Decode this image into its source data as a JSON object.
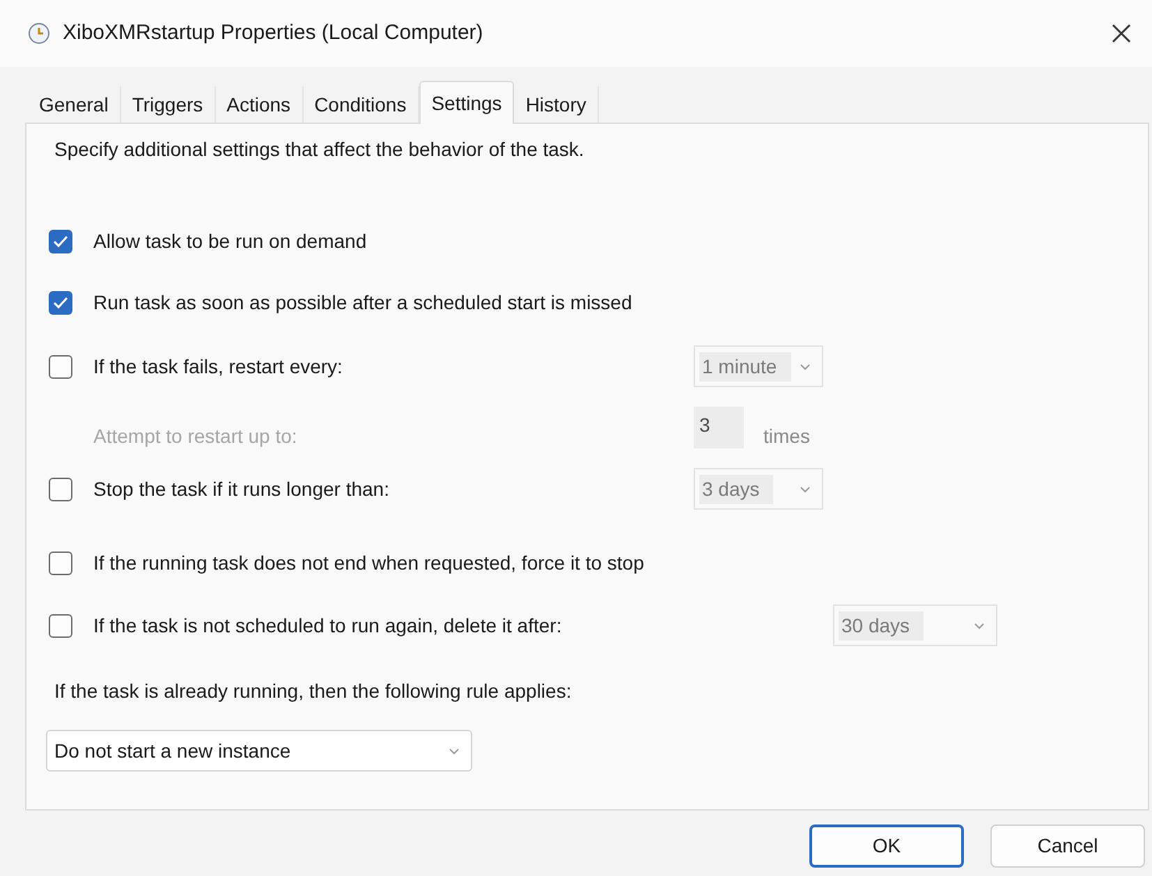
{
  "window": {
    "title": "XiboXMRstartup Properties (Local Computer)"
  },
  "tabs": [
    {
      "label": "General",
      "selected": false
    },
    {
      "label": "Triggers",
      "selected": false
    },
    {
      "label": "Actions",
      "selected": false
    },
    {
      "label": "Conditions",
      "selected": false
    },
    {
      "label": "Settings",
      "selected": true
    },
    {
      "label": "History",
      "selected": false
    }
  ],
  "description": "Specify additional settings that affect the behavior of the task.",
  "options": [
    {
      "kind": "checkbox",
      "label": "Allow task to be run on demand",
      "checked": true
    },
    {
      "kind": "checkbox",
      "label": "Run task as soon as possible after a scheduled start is missed",
      "checked": true
    },
    {
      "kind": "checkbox",
      "label": "If the task fails, restart every:",
      "checked": false,
      "dropdown": {
        "value": "1 minute",
        "disabled": true
      }
    },
    {
      "kind": "number",
      "label": "Attempt to restart up to:",
      "disabled": true,
      "value": "3",
      "unit": "times"
    },
    {
      "kind": "checkbox",
      "label": "Stop the task if it runs longer than:",
      "checked": false,
      "dropdown": {
        "value": "3 days",
        "disabled": true
      }
    },
    {
      "kind": "checkbox",
      "label": "If the running task does not end when requested, force it to stop",
      "checked": false
    },
    {
      "kind": "checkbox",
      "label": "If the task is not scheduled to run again, delete it after:",
      "checked": false,
      "dropdown": {
        "value": "30 days",
        "disabled": true
      }
    }
  ],
  "rule": {
    "label": "If the task is already running, then the following rule applies:",
    "dropdown": {
      "value": "Do not start a new instance",
      "disabled": false
    }
  },
  "buttons": [
    {
      "label": "OK",
      "default": true
    },
    {
      "label": "Cancel",
      "default": false
    }
  ]
}
